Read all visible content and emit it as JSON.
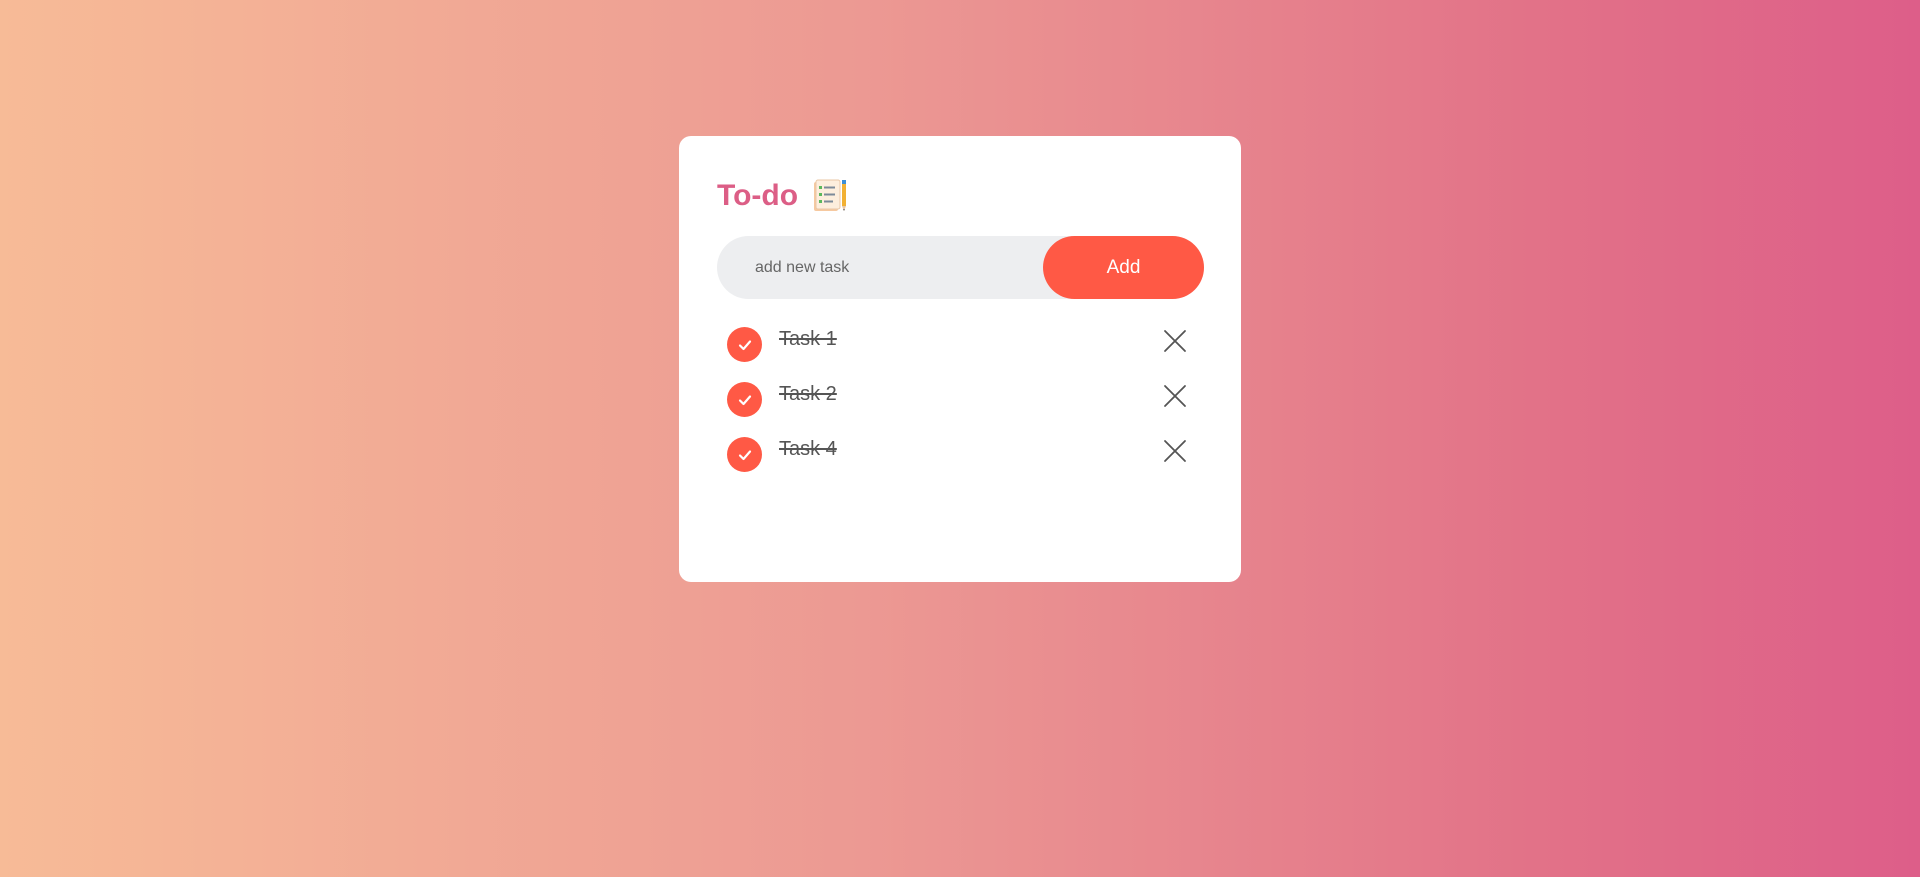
{
  "app": {
    "title": "To-do",
    "icon": "notepad-icon"
  },
  "colors": {
    "accent": "#ff5945",
    "title": "#dc5e86",
    "input_bg": "#edeef0",
    "gradient_start": "#f7bb97",
    "gradient_end": "#dd5e89"
  },
  "input": {
    "placeholder": "add new task",
    "value": ""
  },
  "add_button": {
    "label": "Add"
  },
  "tasks": [
    {
      "label": "Task 1",
      "done": true
    },
    {
      "label": "Task 2",
      "done": true
    },
    {
      "label": "Task 4",
      "done": true
    }
  ]
}
